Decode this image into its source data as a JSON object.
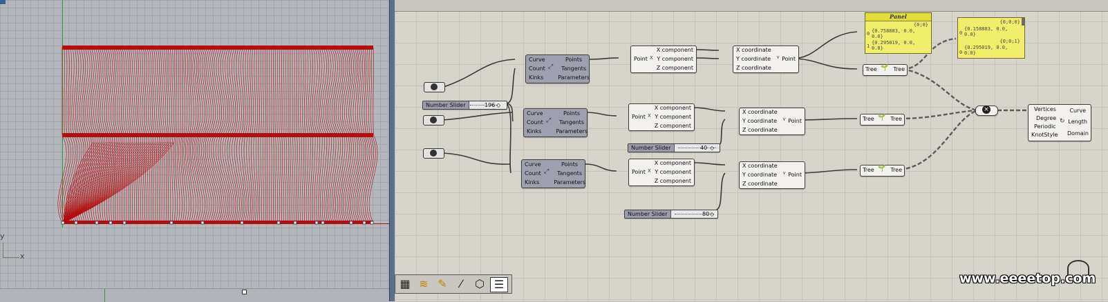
{
  "viewport": {
    "axis_x_label": "x",
    "axis_y_label": "y"
  },
  "components": {
    "divide1": {
      "inputs": [
        "Curve",
        "Count",
        "Kinks"
      ],
      "outputs": [
        "Points",
        "Tangents",
        "Parameters"
      ]
    },
    "divide2": {
      "inputs": [
        "Curve",
        "Count",
        "Kinks"
      ],
      "outputs": [
        "Points",
        "Tangents",
        "Parameters"
      ]
    },
    "divide3": {
      "inputs": [
        "Curve",
        "Count",
        "Kinks"
      ],
      "outputs": [
        "Points",
        "Tangents",
        "Parameters"
      ]
    },
    "deconstruct1": {
      "input": "Point",
      "outputs": [
        "X component",
        "Y component",
        "Z component"
      ]
    },
    "deconstruct2": {
      "input": "Point",
      "outputs": [
        "X component",
        "Y component",
        "Z component"
      ]
    },
    "deconstruct3": {
      "input": "Point",
      "outputs": [
        "X component",
        "Y component",
        "Z component"
      ]
    },
    "construct1": {
      "inputs": [
        "X coordinate",
        "Y coordinate",
        "Z coordinate"
      ],
      "output": "Point"
    },
    "construct2": {
      "inputs": [
        "X coordinate",
        "Y coordinate",
        "Z coordinate"
      ],
      "output": "Point"
    },
    "construct3": {
      "inputs": [
        "X coordinate",
        "Y coordinate",
        "Z coordinate"
      ],
      "output": "Point"
    },
    "flip1": {
      "input": "Tree",
      "output": "Tree"
    },
    "flip2": {
      "input": "Tree",
      "output": "Tree"
    },
    "flip3": {
      "input": "Tree",
      "output": "Tree"
    },
    "interpolate": {
      "inputs": [
        "Vertices",
        "Degree",
        "Periodic",
        "KnotStyle"
      ],
      "outputs": [
        "Curve",
        "Length",
        "Domain"
      ]
    }
  },
  "sliders": [
    {
      "name": "Number Slider",
      "value": "196"
    },
    {
      "name": "Number Slider",
      "value": "40"
    },
    {
      "name": "Number Slider",
      "value": "80"
    }
  ],
  "panel1": {
    "title": "Panel",
    "path": "{0;0}",
    "rows": [
      {
        "index": "0",
        "line1": "{0.758883, 0.0,",
        "line2": "0.0}"
      },
      {
        "index": "1",
        "line1": "{0.295019, 0.0,",
        "line2": "0.0}"
      }
    ]
  },
  "panel2": {
    "path1": "{0;0;0}",
    "line1": "{0.158883, 0.0,",
    "line1b": "0.0}",
    "path2": "{0;0;1}",
    "line2": "{0.295019, 0.0,",
    "line2b": "0.0}"
  },
  "toolbar": {
    "icons": [
      "grid-icon",
      "filter-icon",
      "paint-icon",
      "brush-icon",
      "cube-icon",
      "list-icon"
    ]
  },
  "watermark": "www.eeeetop.com",
  "colors": {
    "curve_red": "#b30d0d",
    "canvas": "#d7d4cc",
    "viewport": "#b4b7bb",
    "panel_yellow": "#f0ee6a"
  }
}
